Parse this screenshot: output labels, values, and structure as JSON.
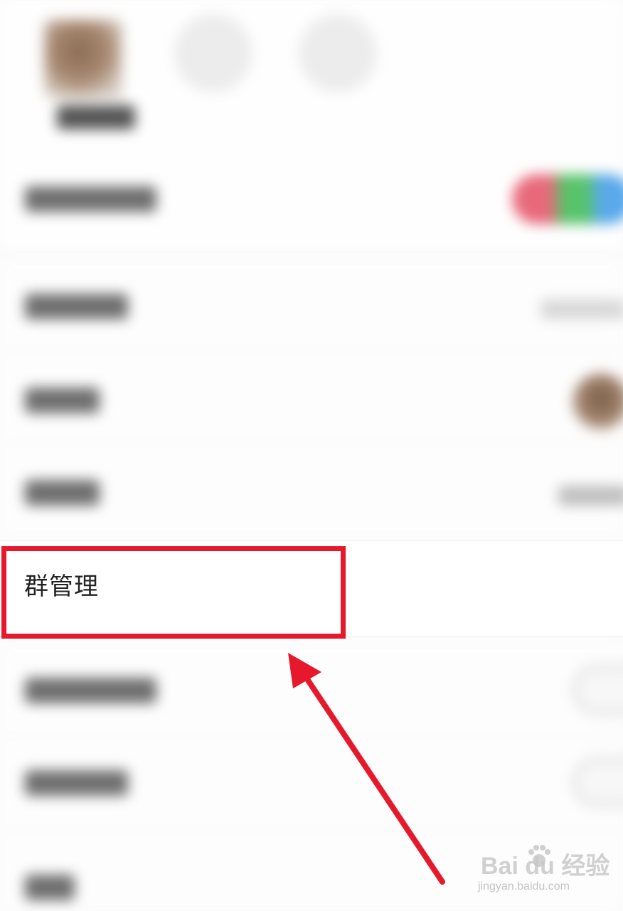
{
  "group_settings": {
    "focus_row": {
      "label": "群管理"
    }
  },
  "annotation": {
    "highlight_color": "#e5192b",
    "arrow_color": "#e5192b"
  },
  "watermark": {
    "brand": "Bai du 经验",
    "url": "jingyan.baidu.com"
  }
}
